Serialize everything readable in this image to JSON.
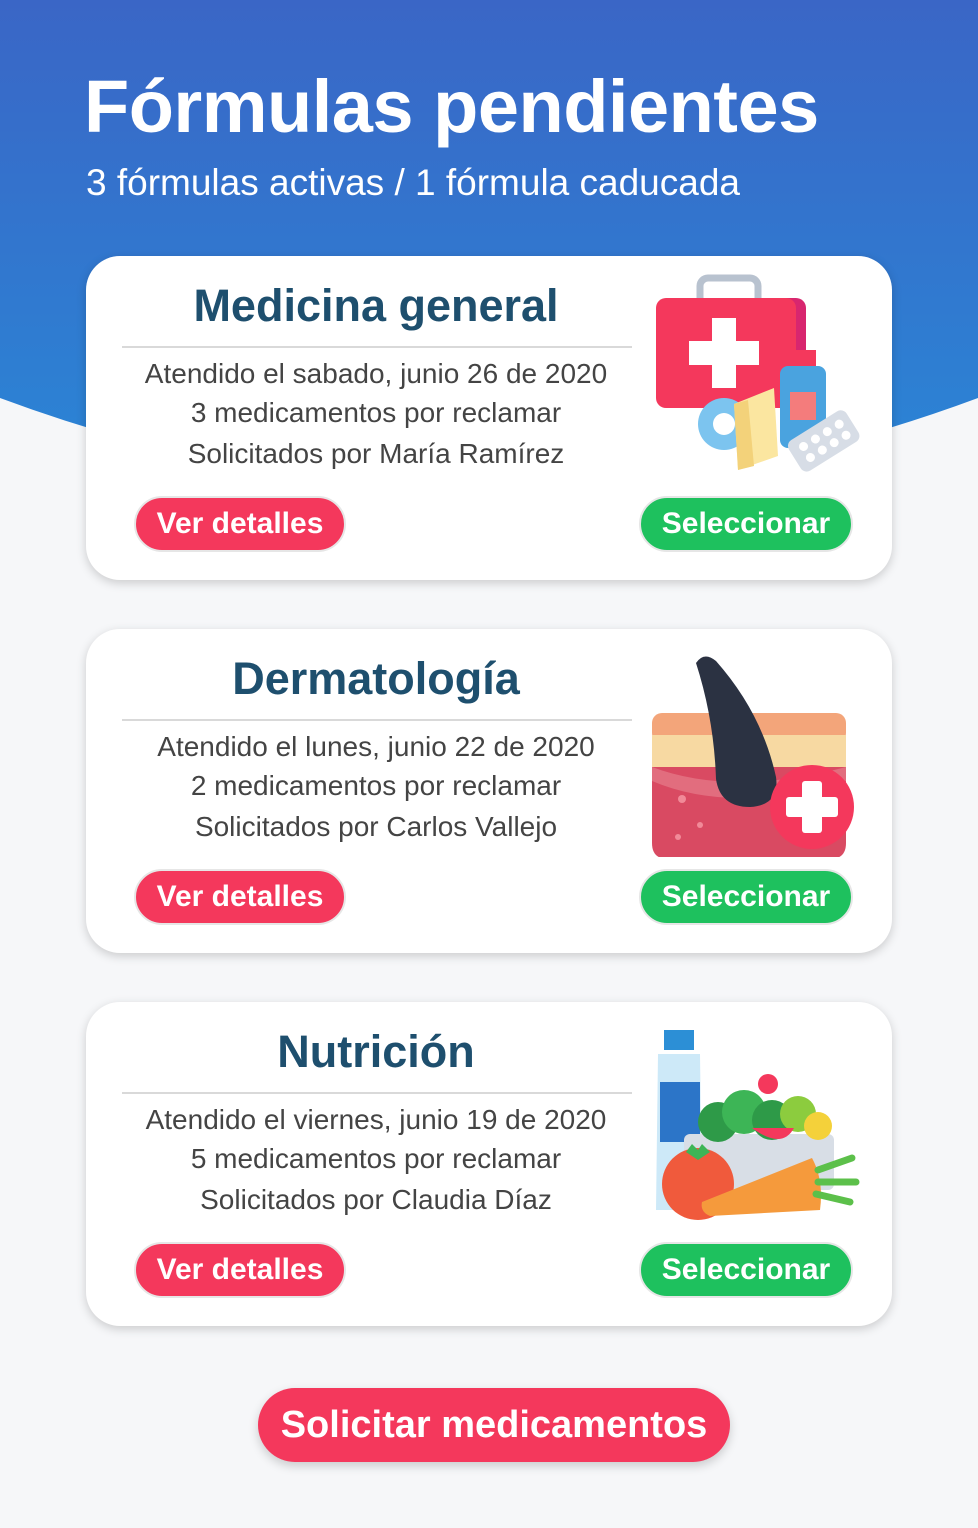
{
  "header": {
    "title": "Fórmulas pendientes",
    "subtitle": "3 fórmulas activas / 1 fórmula caducada",
    "gradient_top": "#3a66c6",
    "gradient_bottom": "#2a86d6"
  },
  "cards": [
    {
      "title": "Medicina general",
      "date": "Atendido el sabado, junio 26 de 2020",
      "meds": "3 medicamentos por reclamar",
      "requested_by": "Solicitados por María Ramírez",
      "details_label": "Ver detalles",
      "select_label": "Seleccionar",
      "icon": "first-aid-kit-icon"
    },
    {
      "title": "Dermatología",
      "date": "Atendido el lunes, junio 22 de 2020",
      "meds": "2 medicamentos por reclamar",
      "requested_by": "Solicitados por Carlos Vallejo",
      "details_label": "Ver detalles",
      "select_label": "Seleccionar",
      "icon": "skin-hair-follicle-icon"
    },
    {
      "title": "Nutrición",
      "date": "Atendido el viernes, junio 19 de 2020",
      "meds": "5 medicamentos por reclamar",
      "requested_by": "Solicitados por Claudia Díaz",
      "details_label": "Ver detalles",
      "select_label": "Seleccionar",
      "icon": "healthy-food-icon"
    }
  ],
  "cta": {
    "label": "Solicitar medicamentos"
  },
  "colors": {
    "danger": "#f4385c",
    "success": "#1ec15e",
    "title_text": "#1e4f6e",
    "background": "#f6f7f9"
  }
}
